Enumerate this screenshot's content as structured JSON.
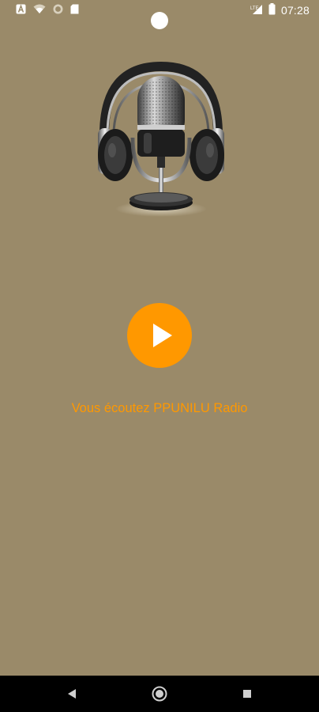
{
  "status_bar": {
    "time": "07:28",
    "left_icons": [
      "font-a-icon",
      "wifi-icon",
      "circle-icon",
      "sd-card-icon"
    ],
    "right_icons": [
      "signal-icon",
      "battery-icon"
    ]
  },
  "artwork": {
    "name": "headphones-microphone-artwork"
  },
  "player": {
    "play_icon": "play-icon",
    "now_playing_text": "Vous écoutez PPUNILU Radio",
    "accent_color": "#ff9800"
  },
  "background_color": "#9a8a69",
  "nav_bar": {
    "buttons": [
      "back-icon",
      "home-icon",
      "recents-icon"
    ]
  }
}
